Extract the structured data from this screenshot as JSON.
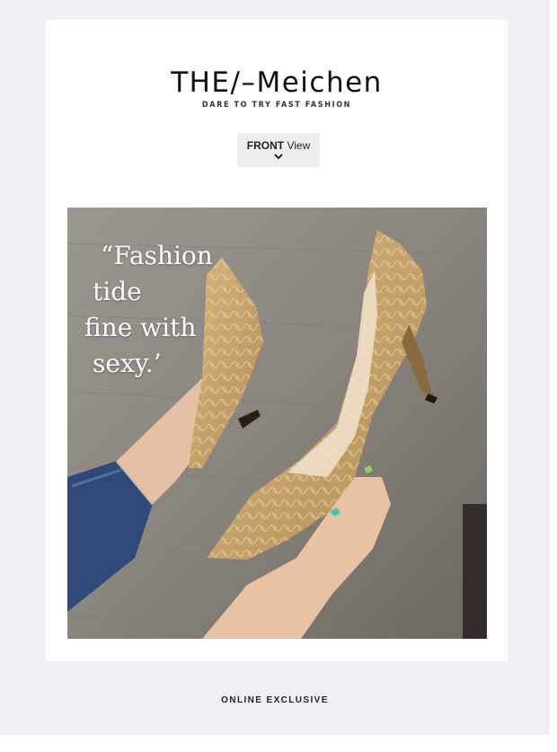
{
  "header": {
    "brand": "THE/–Meichen",
    "tagline": "DARE TO TRY FAST FASHION"
  },
  "view_button": {
    "bold": "FRONT",
    "label": "View",
    "icon": "chevron-down-icon"
  },
  "hero": {
    "quote_lines": [
      "“Fashion",
      "tide",
      "fine with",
      "sexy.’"
    ]
  },
  "footer": {
    "label": "ONLINE EXCLUSIVE"
  },
  "colors": {
    "page_bg": "#eef0f5",
    "card_bg": "#ffffff",
    "button_bg": "#ededed",
    "shoe": "#c8a46c",
    "jeans": "#2f4a78"
  }
}
